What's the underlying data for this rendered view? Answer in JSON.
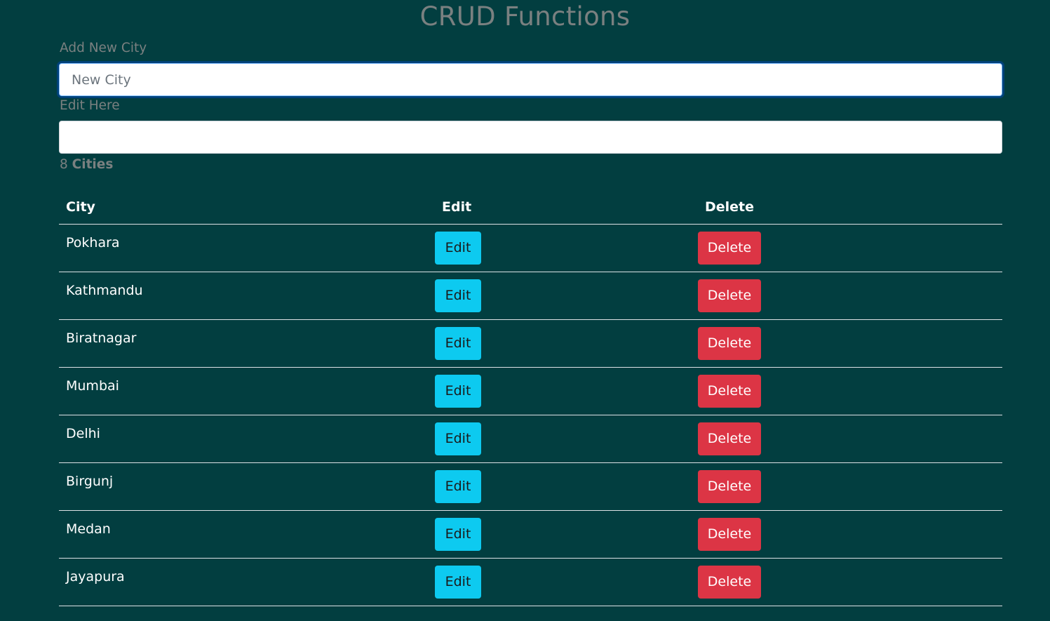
{
  "header": {
    "title": "CRUD Functions"
  },
  "form": {
    "add_label": "Add New City",
    "add_placeholder": "New City",
    "add_value": "",
    "edit_label": "Edit Here",
    "edit_placeholder": "",
    "edit_value": ""
  },
  "summary": {
    "count": "8",
    "count_word": "Cities"
  },
  "table": {
    "headers": [
      "City",
      "Edit",
      "Delete"
    ],
    "edit_label": "Edit",
    "delete_label": "Delete",
    "rows": [
      "Pokhara",
      "Kathmandu",
      "Biratnagar",
      "Mumbai",
      "Delhi",
      "Birgunj",
      "Medan",
      "Jayapura"
    ]
  },
  "colors": {
    "background": "#023e40",
    "edit_button": "#0dcaf0",
    "delete_button": "#dc3545",
    "muted_text": "#7a8080"
  }
}
